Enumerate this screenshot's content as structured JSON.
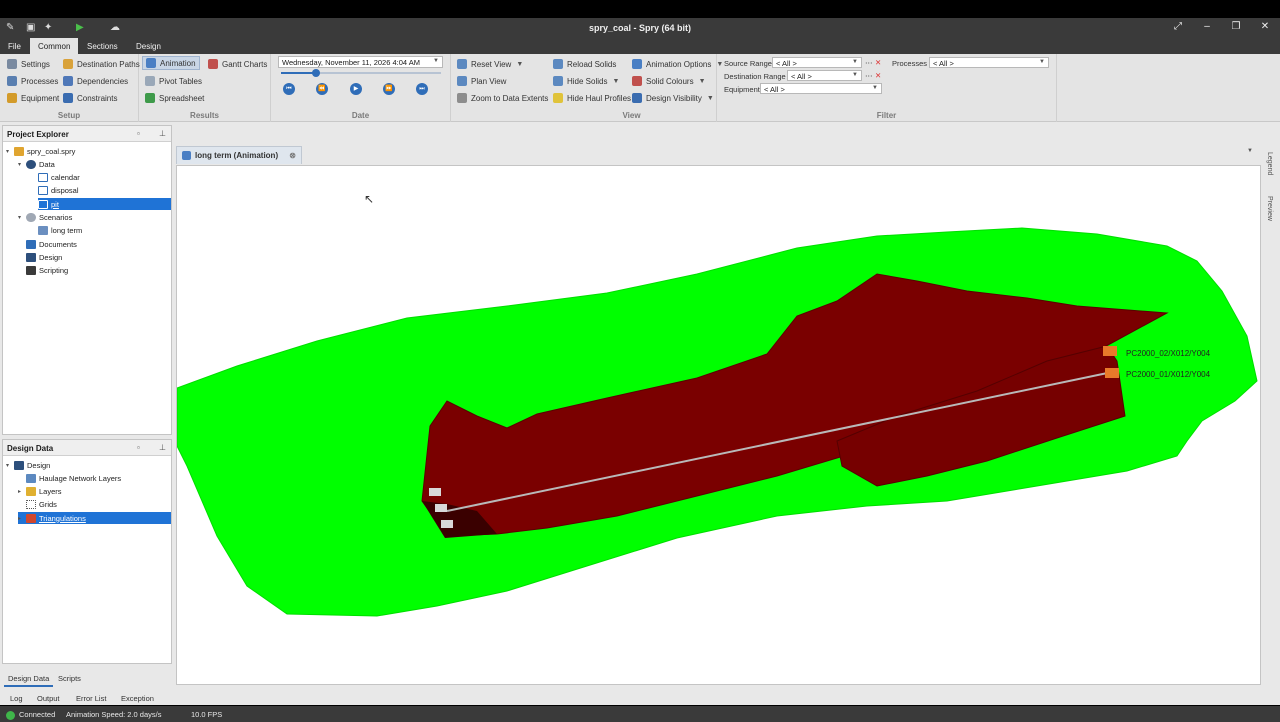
{
  "window": {
    "title": "spry_coal - Spry (64 bit)"
  },
  "menu": {
    "tabs": [
      "File",
      "Common",
      "Sections",
      "Design"
    ],
    "active": "Common"
  },
  "ribbon": {
    "setup": {
      "label": "Setup",
      "items": [
        "Settings",
        "Destination Paths",
        "Processes",
        "Dependencies",
        "Equipment",
        "Constraints"
      ]
    },
    "results": {
      "label": "Results",
      "items": [
        "Animation",
        "Gantt Charts",
        "Pivot Tables",
        "Spreadsheet"
      ]
    },
    "date": {
      "label": "Date",
      "value": "Wednesday, November 11, 2026 4:04 AM",
      "slider_fraction": 0.22
    },
    "view_camera": {
      "items": [
        "Reset View",
        "Plan View",
        "Zoom to Data Extents"
      ]
    },
    "view": {
      "label": "View",
      "items": [
        "Reload Solids",
        "Animation Options",
        "Hide Solids",
        "Solid Colours",
        "Hide Haul Profiles",
        "Design Visibility"
      ]
    },
    "filter": {
      "label": "Filter",
      "source_range_label": "Source Range",
      "source_range_value": "< All >",
      "processes_label": "Processes",
      "processes_value": "< All >",
      "destination_range_label": "Destination Range",
      "destination_range_value": "< All >",
      "equipment_label": "Equipment",
      "equipment_value": "< All >"
    }
  },
  "project_explorer": {
    "title": "Project Explorer",
    "nodes": [
      "spry_coal.spry",
      "Data",
      "calendar",
      "disposal",
      "pit",
      "Scenarios",
      "long term",
      "Documents",
      "Design",
      "Scripting"
    ],
    "selected": "pit"
  },
  "design_data": {
    "title": "Design Data",
    "nodes": [
      "Design",
      "Haulage Network Layers",
      "Layers",
      "Grids",
      "Triangulations"
    ],
    "selected": "Triangulations",
    "tabs": [
      "Design Data",
      "Scripts"
    ]
  },
  "document": {
    "tab_label": "long term (Animation)"
  },
  "scene": {
    "labels": [
      "PC2000_02/X012/Y004",
      "PC2000_01/X012/Y004"
    ],
    "terrain_color": "#00ff00",
    "pit_color": "#7a0000"
  },
  "right_rail": [
    "Legend",
    "Preview"
  ],
  "output_tabs": [
    "Log",
    "Output",
    "Error List",
    "Exception"
  ],
  "status": {
    "connection": "Connected",
    "animation_speed": "Animation Speed: 2.0 days/s",
    "fps": "10.0 FPS"
  }
}
